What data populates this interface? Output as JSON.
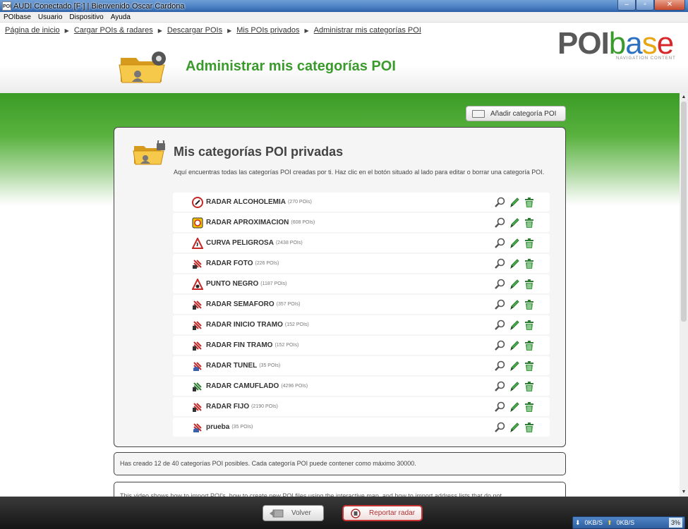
{
  "window": {
    "icon_text": "POI",
    "title": "AUDI Conectado [F:]  |  Bienvenido Oscar Cardona",
    "minimize": "–",
    "maximize": "▫",
    "close": "✕"
  },
  "menu": [
    "POIbase",
    "Usuario",
    "Dispositivo",
    "Ayuda"
  ],
  "breadcrumb": [
    "Página de inicio",
    "Cargar POIs & radares",
    "Descargar POIs",
    "Mis POIs privados",
    "Administrar mis categorías POI"
  ],
  "header": {
    "title": "Administrar mis categorías POI",
    "logo_poi": "POI",
    "logo_b": "b",
    "logo_a": "a",
    "logo_s": "s",
    "logo_e": "e",
    "logo_tagline": "NAVIGATION CONTENT"
  },
  "add_button": "Añadir categoría POI",
  "panel": {
    "title": "Mis categorías POI privadas",
    "description": "Aquí encuentras todas las categorías POI creadas por ti. Haz clic en el botón situado al lado para editar o borrar una categoría POI.",
    "categories": [
      {
        "name": "RADAR ALCOHOLEMIA",
        "count": "(270 POIs)",
        "icon": "alcohol-radar-icon"
      },
      {
        "name": "RADAR APROXIMACION",
        "count": "(608 POIs)",
        "icon": "approach-radar-icon"
      },
      {
        "name": "CURVA PELIGROSA",
        "count": "(2438 POIs)",
        "icon": "dangerous-curve-icon"
      },
      {
        "name": "RADAR FOTO",
        "count": "(226 POIs)",
        "icon": "photo-radar-icon"
      },
      {
        "name": "PUNTO NEGRO",
        "count": "(1187 POIs)",
        "icon": "black-spot-icon"
      },
      {
        "name": "RADAR SEMAFORO",
        "count": "(357 POIs)",
        "icon": "traffic-light-radar-icon"
      },
      {
        "name": "RADAR INICIO TRAMO",
        "count": "(152 POIs)",
        "icon": "section-start-radar-icon"
      },
      {
        "name": "RADAR FIN TRAMO",
        "count": "(152 POIs)",
        "icon": "section-end-radar-icon"
      },
      {
        "name": "RADAR TUNEL",
        "count": "(35 POIs)",
        "icon": "tunnel-radar-icon"
      },
      {
        "name": "RADAR CAMUFLADO",
        "count": "(4296 POIs)",
        "icon": "hidden-radar-icon"
      },
      {
        "name": "RADAR FIJO",
        "count": "(2190 POIs)",
        "icon": "fixed-radar-icon"
      },
      {
        "name": "prueba",
        "count": "(35 POIs)",
        "icon": "test-radar-icon"
      }
    ]
  },
  "info_text": "Has creado 12 de 40 categorías POI posibles. Cada categoría POI puede contener como máximo 30000.",
  "video_text": "This video shows how to import POI's, how to create new POI files using the interactive map, and how to import address lists that do not",
  "footer": {
    "back": "Volver",
    "report": "Reportar radar"
  },
  "status": {
    "down": "0KB/S",
    "up": "0KB/S",
    "percent": "3%"
  },
  "colors": {
    "accent_green": "#3a9b2c",
    "report_red": "#c73232",
    "titlebar_blue": "#4a7fc2"
  }
}
